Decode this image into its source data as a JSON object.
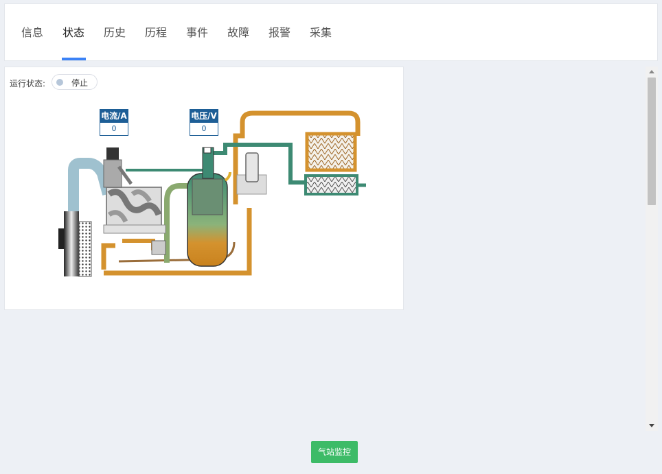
{
  "tabs": [
    {
      "label": "信息"
    },
    {
      "label": "状态"
    },
    {
      "label": "历史"
    },
    {
      "label": "历程"
    },
    {
      "label": "事件"
    },
    {
      "label": "故障"
    },
    {
      "label": "报警"
    },
    {
      "label": "采集"
    }
  ],
  "active_tab": "状态",
  "status": {
    "label": "运行状态:",
    "value": "停止"
  },
  "meters": {
    "current": {
      "label": "电流/A",
      "value": "0"
    },
    "voltage": {
      "label": "电压/V",
      "value": "0"
    }
  },
  "footer": {
    "monitor_label": "气站监控"
  },
  "colors": {
    "accent": "#3b82f6",
    "button": "#3dbb67",
    "meter": "#1d5e96",
    "pipe_orange": "#d4922e",
    "pipe_green": "#3d8a73",
    "pipe_blue": "#9fc1cf"
  }
}
